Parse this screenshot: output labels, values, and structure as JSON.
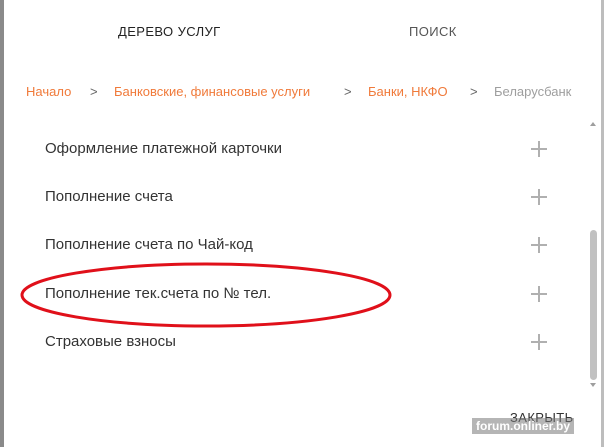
{
  "tabs": {
    "tree_label": "ДЕРЕВО УСЛУГ",
    "search_label": "ПОИСК"
  },
  "breadcrumb": {
    "items": [
      "Начало",
      "Банковские, финансовые услуги",
      "Банки, НКФО",
      "Беларусбанк"
    ],
    "separator": ">"
  },
  "services": [
    {
      "label": "Оформление платежной карточки",
      "icon": "plus-icon"
    },
    {
      "label": "Пополнение счета",
      "icon": "plus-icon"
    },
    {
      "label": "Пополнение счета по Чай-код",
      "icon": "plus-icon"
    },
    {
      "label": "Пополнение тек.счета по № тел.",
      "icon": "plus-icon",
      "highlighted": true
    },
    {
      "label": "Страховые взносы",
      "icon": "plus-icon"
    }
  ],
  "footer": {
    "close_label": "ЗАКРЫТЬ"
  },
  "watermark": "forum.onliner.by",
  "colors": {
    "accent": "#f07a3a",
    "highlight_oval": "#e0101a",
    "muted": "#9e9e9e"
  }
}
